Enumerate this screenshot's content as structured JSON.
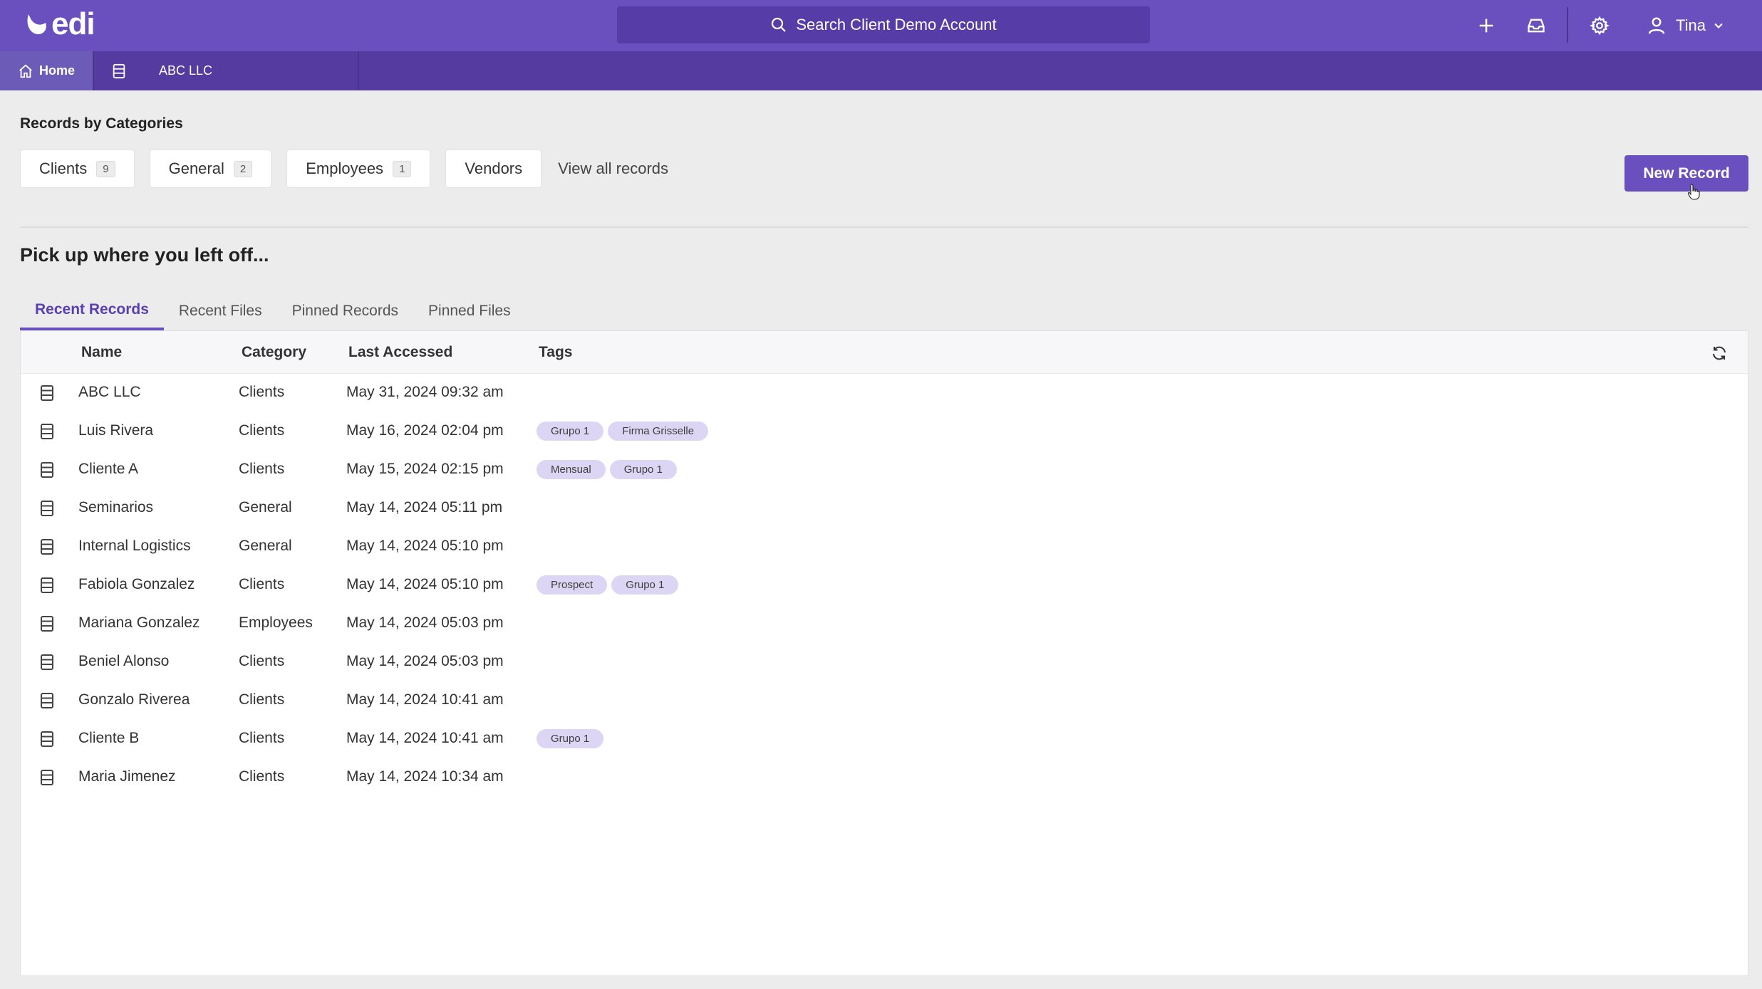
{
  "header": {
    "logo_text": "edi",
    "search_placeholder": "Search Client Demo Account",
    "user_name": "Tina",
    "brand_color": "#6a4fbf"
  },
  "tabbar": {
    "home_label": "Home",
    "record_tab_label": "ABC LLC"
  },
  "categories": {
    "title": "Records by Categories",
    "chips": [
      {
        "label": "Clients",
        "count": "9"
      },
      {
        "label": "General",
        "count": "2"
      },
      {
        "label": "Employees",
        "count": "1"
      },
      {
        "label": "Vendors",
        "count": ""
      }
    ],
    "view_all": "View all records",
    "new_record": "New Record"
  },
  "recent": {
    "title": "Pick up where you left off...",
    "tabs": [
      "Recent Records",
      "Recent Files",
      "Pinned Records",
      "Pinned Files"
    ],
    "active_tab": "Recent Records",
    "columns": [
      "Name",
      "Category",
      "Last Accessed",
      "Tags"
    ],
    "rows": [
      {
        "name": "ABC LLC",
        "category": "Clients",
        "accessed": "May 31, 2024 09:32 am",
        "tags": []
      },
      {
        "name": "Luis Rivera",
        "category": "Clients",
        "accessed": "May 16, 2024 02:04 pm",
        "tags": [
          "Grupo 1",
          "Firma Grisselle"
        ]
      },
      {
        "name": "Cliente A",
        "category": "Clients",
        "accessed": "May 15, 2024 02:15 pm",
        "tags": [
          "Mensual",
          "Grupo 1"
        ]
      },
      {
        "name": "Seminarios",
        "category": "General",
        "accessed": "May 14, 2024 05:11 pm",
        "tags": []
      },
      {
        "name": "Internal Logistics",
        "category": "General",
        "accessed": "May 14, 2024 05:10 pm",
        "tags": []
      },
      {
        "name": "Fabiola Gonzalez",
        "category": "Clients",
        "accessed": "May 14, 2024 05:10 pm",
        "tags": [
          "Prospect",
          "Grupo 1"
        ]
      },
      {
        "name": "Mariana Gonzalez",
        "category": "Employees",
        "accessed": "May 14, 2024 05:03 pm",
        "tags": []
      },
      {
        "name": "Beniel Alonso",
        "category": "Clients",
        "accessed": "May 14, 2024 05:03 pm",
        "tags": []
      },
      {
        "name": "Gonzalo Riverea",
        "category": "Clients",
        "accessed": "May 14, 2024 10:41 am",
        "tags": []
      },
      {
        "name": "Cliente B",
        "category": "Clients",
        "accessed": "May 14, 2024 10:41 am",
        "tags": [
          "Grupo 1"
        ]
      },
      {
        "name": "Maria Jimenez",
        "category": "Clients",
        "accessed": "May 14, 2024 10:34 am",
        "tags": []
      }
    ]
  }
}
